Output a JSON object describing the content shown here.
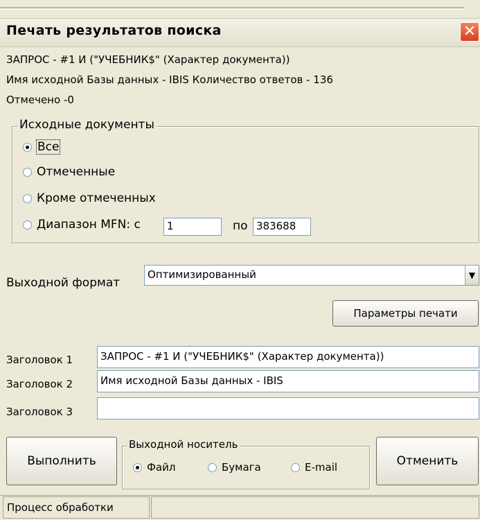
{
  "dialog": {
    "title": "Печать результатов поиска",
    "close_icon": "close-icon"
  },
  "info": {
    "query_line": "ЗАПРОС - #1 И (\"УЧЕБНИК$\" (Характер документа))",
    "db_line": "Имя исходной Базы данных - IBIS  Количество ответов - 136",
    "marked_line": "Отмечено -0"
  },
  "source_docs": {
    "group_label": "Исходные документы",
    "options": [
      "Все",
      "Отмеченные",
      "Кроме отмеченных",
      "Диапазон MFN:  с"
    ],
    "selected": "Все",
    "range_from": "1",
    "range_to_label": "по",
    "range_to": "383688"
  },
  "output_format": {
    "label": "Выходной формат",
    "value": "Оптимизированный"
  },
  "print_params_button": "Параметры печати",
  "headers": [
    {
      "label": "Заголовок 1",
      "value": "ЗАПРОС - #1 И (\"УЧЕБНИК$\" (Характер документа))"
    },
    {
      "label": "Заголовок 2",
      "value": "Имя исходной Базы данных - IBIS"
    },
    {
      "label": "Заголовок 3",
      "value": ""
    }
  ],
  "run_button": "Выполнить",
  "output_media": {
    "group_label": "Выходной носитель",
    "options": [
      "Файл",
      "Бумага",
      "E-mail"
    ],
    "selected": "Файл"
  },
  "cancel_button": "Отменить",
  "status_bar": {
    "text": "Процесс обработки"
  }
}
